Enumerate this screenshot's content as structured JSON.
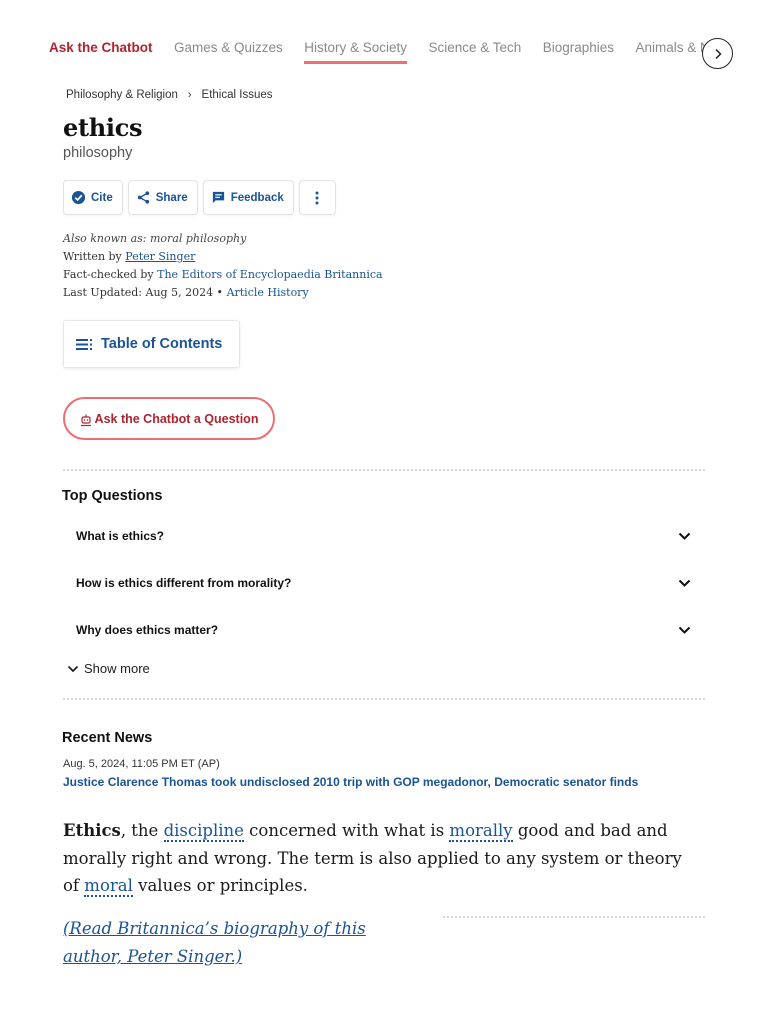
{
  "nav": {
    "items": [
      {
        "label": "Ask the Chatbot"
      },
      {
        "label": "Games & Quizzes"
      },
      {
        "label": "History & Society"
      },
      {
        "label": "Science & Tech"
      },
      {
        "label": "Biographies"
      },
      {
        "label": "Animals & Nature"
      }
    ],
    "active": "History & Society",
    "next_icon": "chevron-right-icon"
  },
  "breadcrumb": [
    "Philosophy & Religion",
    "Ethical Issues"
  ],
  "article": {
    "title": "ethics",
    "subtitle": "philosophy",
    "actions": {
      "cite": "Cite",
      "share": "Share",
      "feedback": "Feedback"
    },
    "also_known_as": "Also known as: moral philosophy",
    "written_by_label": "Written by",
    "author": "Peter Singer",
    "fact_checked_label": "Fact-checked by",
    "fact_checker": "The Editors of Encyclopaedia Britannica",
    "last_updated": "Last Updated: Aug 5, 2024 •",
    "article_history": "Article History"
  },
  "toc": {
    "label": "Table of Contents"
  },
  "chatbot": {
    "label": "Ask the Chatbot a Question"
  },
  "top_questions": {
    "heading": "Top Questions",
    "items": [
      "What is ethics?",
      "How is ethics different from morality?",
      "Why does ethics matter?"
    ],
    "show_more": "Show more"
  },
  "recent_news": {
    "heading": "Recent News",
    "date": "Aug. 5, 2024, 11:05 PM ET (AP)",
    "headline": "Justice Clarence Thomas took undisclosed 2010 trip with GOP megadonor, Democratic senator finds"
  },
  "body": {
    "term": "Ethics",
    "part1": ", the ",
    "link1": "discipline",
    "part2": " concerned with what is ",
    "link2": "morally",
    "part3": " good and bad and morally right and wrong. The term is also applied to any system or theory of ",
    "link3": "moral",
    "part4": " values or principles.",
    "bio_link": "(Read Britannica’s biography of this author, Peter Singer.)"
  },
  "colors": {
    "accent": "#b0232f",
    "link": "#1a5396",
    "nav_underline": "#ec6e73"
  }
}
